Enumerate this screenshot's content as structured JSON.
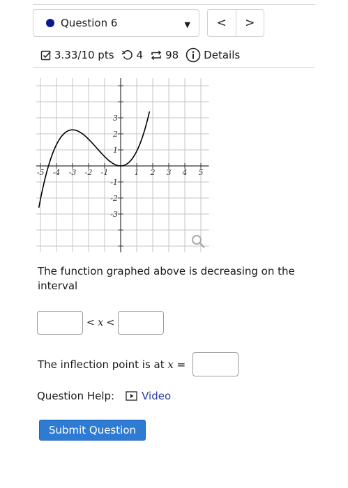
{
  "question_selector": {
    "label": "Question 6",
    "dot_color": "#0a1a8c"
  },
  "nav": {
    "prev": "<",
    "next": ">"
  },
  "status": {
    "score": "3.33/10 pts",
    "retries": "4",
    "attempts": "98",
    "details": "Details"
  },
  "graph": {
    "x_ticks": [
      "-5",
      "-4",
      "-3",
      "-2",
      "-1",
      "1",
      "2",
      "3",
      "4",
      "5"
    ],
    "y_ticks": [
      "3",
      "2",
      "1",
      "-1",
      "-2",
      "-3"
    ]
  },
  "chart_data": {
    "type": "line",
    "x_range": [
      -5,
      5
    ],
    "y_range": [
      -3,
      3
    ],
    "grid": true,
    "series": [
      {
        "function": "x^3/6 + 3x^2/4",
        "local_max": [
          -3,
          2.25
        ],
        "local_min": [
          0,
          0
        ],
        "x_intercepts": [
          -4.5,
          0
        ]
      }
    ]
  },
  "prompt": {
    "text": "The function graphed above is decreasing on the interval"
  },
  "interval": {
    "lt1": "<",
    "var": "x",
    "lt2": "<"
  },
  "inflection": {
    "label": "The inflection point is at",
    "var": "x",
    "eq": "="
  },
  "help": {
    "label": "Question Help:",
    "video": "Video"
  },
  "submit": {
    "label": "Submit Question"
  },
  "colors": {
    "accent": "#2e7bd3",
    "link": "#2a3aa8"
  }
}
